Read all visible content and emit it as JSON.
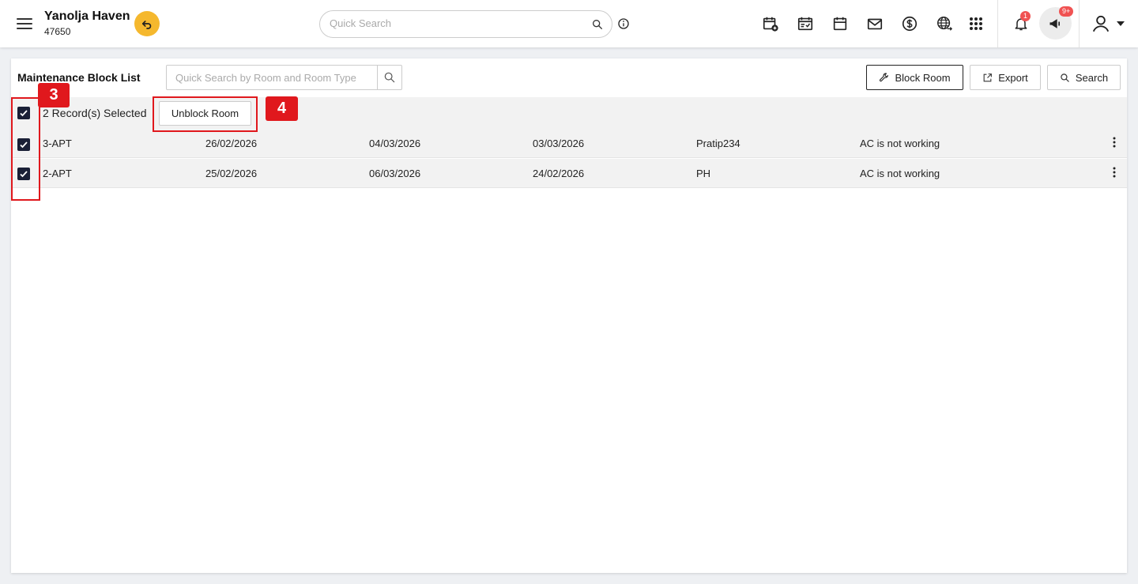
{
  "header": {
    "property_name": "Yanolja Haven",
    "property_code": "47650",
    "quick_search_placeholder": "Quick Search",
    "notification_count": "1",
    "announcement_count": "9+",
    "icons": [
      "menu-icon",
      "undo-icon",
      "search-icon",
      "info-icon",
      "calendar-add-icon",
      "calendar-check-icon",
      "calendar-icon",
      "mail-icon",
      "dollar-icon",
      "globe-icon",
      "apps-grid-icon",
      "bell-icon",
      "megaphone-icon",
      "user-icon",
      "caret-down-icon"
    ],
    "colors": {
      "back_button": "#f5b82e",
      "badge": "#f05252"
    }
  },
  "card": {
    "title": "Maintenance Block List",
    "room_search_placeholder": "Quick Search by Room and Room Type",
    "buttons": {
      "block_room": "Block Room",
      "export": "Export",
      "search": "Search"
    }
  },
  "selection": {
    "text": "2 Record(s) Selected",
    "unblock_label": "Unblock Room"
  },
  "rows": [
    {
      "room": "3-APT",
      "from": "26/02/2026",
      "to": "04/03/2026",
      "created": "03/03/2026",
      "user": "Pratip234",
      "reason": "AC is not working"
    },
    {
      "room": "2-APT",
      "from": "25/02/2026",
      "to": "06/03/2026",
      "created": "24/02/2026",
      "user": "PH",
      "reason": "AC is not working"
    }
  ],
  "annotations": {
    "step_3": "3",
    "step_4": "4",
    "color": "#e0181d"
  }
}
